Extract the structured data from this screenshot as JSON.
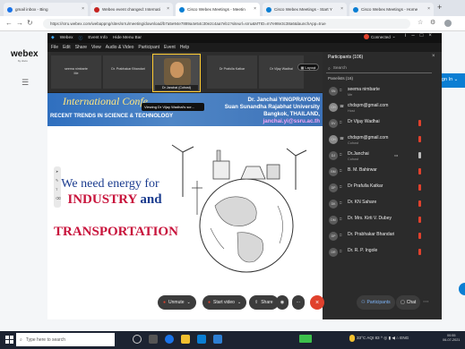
{
  "browser": {
    "tabs": [
      {
        "label": "gmail inbox - Bing",
        "color": "#1a73e8"
      },
      {
        "label": "Webex event changed: Internati",
        "color": "#c5221f"
      },
      {
        "label": "Cisco Webex Meetings - Meetin",
        "color": "#0a7ed3",
        "active": true
      },
      {
        "label": "Cisco Webex Meetings - Start Y",
        "color": "#0a7ed3"
      },
      {
        "label": "Cisco Webex Meetings - Home",
        "color": "#0a7ed3"
      }
    ],
    "new_tab": "+",
    "url": "https://srru.webex.com/webappng/sites/srru/meeting/download/b7a5e94e7889a4e54c30e2c4aa7eb1?siteurl=srru&MTID=m7e98e3c38a6&launchApp=true"
  },
  "webex_site": {
    "logo": "webex",
    "logo_sub": "by cisco",
    "sign_in": "Sign In"
  },
  "meeting_window": {
    "title_items": [
      "Webex",
      "Event Info",
      "Hide Menu Bar"
    ],
    "status": "Connected",
    "menu": [
      "File",
      "Edit",
      "Share",
      "View",
      "Audio & Video",
      "Participant",
      "Event",
      "Help"
    ],
    "layout_button": "Layout",
    "video_tiles": [
      {
        "name": "seema nimbarte",
        "sub": "Me"
      },
      {
        "name": "Dr. Prabhakar Bhandari",
        "sub": ""
      },
      {
        "name": "Dr Janchai (Cohost)",
        "sub": "",
        "active": true
      },
      {
        "name": "Dr Prafulla Katkar",
        "sub": ""
      },
      {
        "name": "Dr Vijay Wadhai",
        "sub": ""
      }
    ],
    "tooltip": "Viewing Dr Vijay Wadhai's scr..."
  },
  "slide": {
    "conference_title": "International Confe",
    "conference_subtitle": "RECENT TRENDS IN SCIENCE & TECHNOLOGY",
    "speaker_name": "Dr. Janchai YINGPRAYOON",
    "speaker_university": "Suan Sunandha Rajabhat University",
    "speaker_location": "Bangkok, THAILAND,",
    "speaker_email": "janchai.yi@ssru.ac.th",
    "line1": "We need energy for",
    "line2_a": "INDUSTRY",
    "line2_and": "and",
    "line3": "TRANSPORTATION"
  },
  "participants": {
    "header": "Participants (106)",
    "search_placeholder": "Search",
    "panelists_label": "Panelists (16)",
    "list": [
      {
        "initials": "SN",
        "name": "seema nimbarte",
        "role": "Me"
      },
      {
        "initials": "CH",
        "name": "chdspm@gmail.com",
        "role": "Host"
      },
      {
        "initials": "DV",
        "name": "Dr Vijay Wadhai",
        "role": ""
      },
      {
        "initials": "CH",
        "name": "chdspm@gmail.com",
        "role": "Cohost"
      },
      {
        "initials": "DJ",
        "name": "Dr.Janchai",
        "role": "Cohost"
      },
      {
        "initials": "BM",
        "name": "B. M. Bahirwar",
        "role": ""
      },
      {
        "initials": "DP",
        "name": "Dr Prafulla Katkar",
        "role": ""
      },
      {
        "initials": "DK",
        "name": "Dr. KN Sahare",
        "role": ""
      },
      {
        "initials": "DM",
        "name": "Dr. Mrs. Kirti V. Dubey",
        "role": ""
      },
      {
        "initials": "DP",
        "name": "Dr. Prabhakar Bhandari",
        "role": ""
      },
      {
        "initials": "DR",
        "name": "Dr. R. P. Ingole",
        "role": ""
      }
    ]
  },
  "controls": {
    "unmute": "Unmute",
    "start_video": "Start video",
    "share": "Share",
    "participants": "Participants",
    "chat": "Chat"
  },
  "taskbar": {
    "search_placeholder": "Type here to search",
    "weather": "33°C AQI 83",
    "language": "ENG",
    "time": "00:55",
    "date": "06-07-2021"
  },
  "colors": {
    "webex_blue": "#0a7ed3",
    "end_red": "#e0412d",
    "slide_blue": "#2f6fbf",
    "slide_red": "#c8143c"
  }
}
